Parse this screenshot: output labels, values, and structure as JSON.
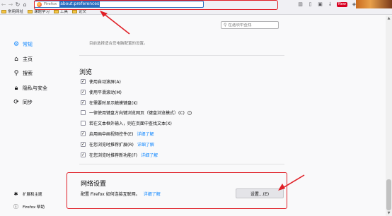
{
  "browser": {
    "url_label": "Firefox",
    "url": "about:preferences",
    "ext_badge": "New",
    "bookmarks": [
      "常用网址",
      "课题学习",
      "工具",
      "论文"
    ]
  },
  "search": {
    "placeholder": "在选项中查找"
  },
  "sidebar": {
    "items": [
      {
        "label": "常规",
        "icon": "gear-icon"
      },
      {
        "label": "主页",
        "icon": "home-icon"
      },
      {
        "label": "搜索",
        "icon": "search-icon"
      },
      {
        "label": "隐私与安全",
        "icon": "lock-icon"
      },
      {
        "label": "同步",
        "icon": "sync-icon"
      }
    ],
    "footer": [
      {
        "label": "扩展和主题",
        "icon": "puzzle-icon"
      },
      {
        "label": "Firefox 帮助",
        "icon": "help-icon"
      }
    ]
  },
  "main": {
    "faded_text": "目前选择适合您电脑配置的设置。",
    "browsing": {
      "title": "浏览",
      "options": [
        {
          "label": "使用自动滚屏(A)",
          "checked": true
        },
        {
          "label": "使用平滑滚动(M)",
          "checked": true
        },
        {
          "label": "在需要时显示触摸键盘(K)",
          "checked": true
        },
        {
          "label": "一律使用键盘方向键浏览网页（键盘浏览模式）(C)",
          "checked": false,
          "help": "?"
        },
        {
          "label": "若在文本框外输入，则在页面中查找文本(X)",
          "checked": false
        },
        {
          "label": "启用画中画视频控件(E)",
          "checked": true,
          "link": "详细了解"
        },
        {
          "label": "在您浏览时推荐扩展(R)",
          "checked": true,
          "link": "详细了解"
        },
        {
          "label": "在您浏览时推荐新功能(F)",
          "checked": true,
          "link": "详细了解"
        }
      ]
    },
    "network": {
      "title": "网络设置",
      "desc": "配置 Firefox 如何连接互联网。",
      "link": "详细了解",
      "button": "设置...(E)"
    }
  },
  "colors": {
    "accent": "#0a84ff",
    "highlight": "#e01f26"
  }
}
